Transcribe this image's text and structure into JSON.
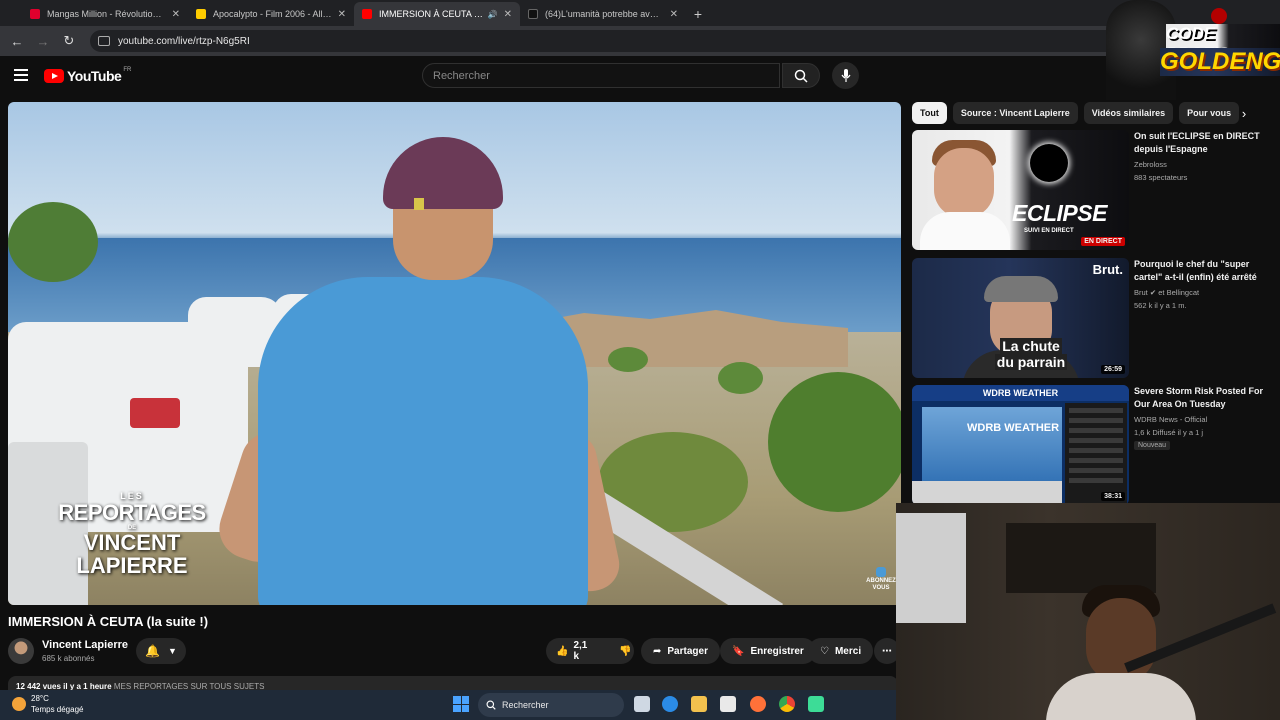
{
  "browser": {
    "tabs": [
      {
        "label": "Mangas Million - Révolution de",
        "favicon_color": "#e1002d",
        "active": false
      },
      {
        "label": "Apocalypto - Film 2006 - AlloC",
        "favicon_color": "#fecc00",
        "active": false
      },
      {
        "label": "IMMERSION À CEUTA (la sui",
        "favicon_color": "#ff0000",
        "active": true
      },
      {
        "label": "(64)L'umanità potrebbe aver ap",
        "favicon_color": "#111111",
        "active": false
      }
    ],
    "url": "youtube.com/live/rtzp-N6g5RI"
  },
  "youtube": {
    "logo_text": "YouTube",
    "country_code": "FR",
    "search_placeholder": "Rechercher"
  },
  "video": {
    "overlay_small": "LES",
    "overlay_big": "REPORTAGES",
    "overlay_tiny": "DE",
    "overlay_name": "VINCENT LAPIERRE",
    "subscribe_overlay": "ABONNEZ VOUS",
    "title": "IMMERSION À CEUTA (la suite !)",
    "channel_name": "Vincent Lapierre",
    "subscribers": "685 k abonnés",
    "likes": "2,1 k",
    "share_label": "Partager",
    "save_label": "Enregistrer",
    "thanks_label": "Merci",
    "description_stats": "12 442 vues  il y a 1 heure",
    "description_link": "MES REPORTAGES SUR TOUS SUJETS"
  },
  "chips": [
    "Tout",
    "Source : Vincent Lapierre",
    "Vidéos similaires",
    "Pour vous"
  ],
  "related": [
    {
      "title": "On suit l'ECLIPSE en DIRECT depuis l'Espagne",
      "channel": "Zebroloss",
      "meta": "883 spectateurs",
      "thumb_big": "ECLIPSE",
      "thumb_small": "SUIVI EN DIRECT",
      "live_badge": "EN DIRECT"
    },
    {
      "title": "Pourquoi le chef du \"super cartel\" a-t-il (enfin) été arrêté",
      "channel": "Brut",
      "channel_extra": "et Bellingcat",
      "meta": "562 k  il y a 1 m.",
      "thumb_brand": "Brut.",
      "thumb_line1": "La chute",
      "thumb_line2": "du parrain",
      "duration": "26:59"
    },
    {
      "title": "Severe Storm Risk Posted For Our Area On Tuesday",
      "channel": "WDRB News - Official",
      "meta": "1,6 k  Diffusé il y a 1 j",
      "badge": "Nouveau",
      "thumb_header": "WDRB WEATHER",
      "thumb_logo": "WDRB WEATHER",
      "duration": "38:31"
    }
  ],
  "streamer_logo": {
    "line1": "CODE PROZIS",
    "line2": "GOLDENG"
  },
  "taskbar": {
    "temperature": "28°C",
    "weather_text": "Temps dégagé",
    "search_label": "Rechercher"
  }
}
